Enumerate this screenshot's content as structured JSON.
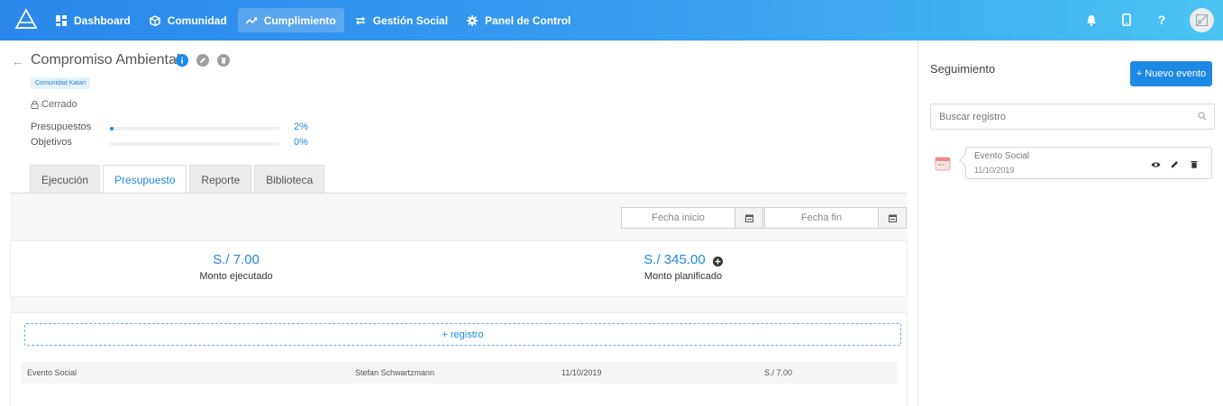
{
  "nav": {
    "items": [
      {
        "label": "Dashboard",
        "icon": "dashboard-icon"
      },
      {
        "label": "Comunidad",
        "icon": "cube-icon"
      },
      {
        "label": "Cumplimiento",
        "icon": "trending-up-icon"
      },
      {
        "label": "Gestión Social",
        "icon": "swap-icon"
      },
      {
        "label": "Panel de Control",
        "icon": "gear-icon"
      }
    ],
    "active": "Cumplimiento",
    "help_label": "?"
  },
  "project": {
    "title": "Compromiso Ambiental",
    "tag": "Comunidad Katari",
    "status": "Cerrado",
    "progress": [
      {
        "label": "Presupuestos",
        "value": "2%",
        "fraction": 0.02
      },
      {
        "label": "Objetivos",
        "value": "0%",
        "fraction": 0.0
      }
    ]
  },
  "tabs": [
    {
      "label": "Ejecución"
    },
    {
      "label": "Presupuesto"
    },
    {
      "label": "Reporte"
    },
    {
      "label": "Biblioteca"
    }
  ],
  "active_tab": "Presupuesto",
  "filters": {
    "start_placeholder": "Fecha inicio",
    "end_placeholder": "Fecha fin"
  },
  "summary": {
    "executed_value": "S./ 7.00",
    "executed_label": "Monto ejecutado",
    "planned_value": "S./ 345.00",
    "planned_label": "Monto planificado"
  },
  "records": {
    "add_label": "+ registro",
    "rows": [
      {
        "name": "Evento Social",
        "user": "Stefan Schwartzmann",
        "date": "11/10/2019",
        "amount": "S./ 7.00"
      }
    ]
  },
  "sidebar": {
    "title": "Seguimiento",
    "new_button": "+ Nuevo evento",
    "search_placeholder": "Buscar registro",
    "events": [
      {
        "name": "Evento Social",
        "date": "11/10/2019"
      }
    ]
  },
  "colors": {
    "accent": "#1e88e5",
    "nav_start": "#2b87ea",
    "nav_end": "#4cc4f2"
  }
}
